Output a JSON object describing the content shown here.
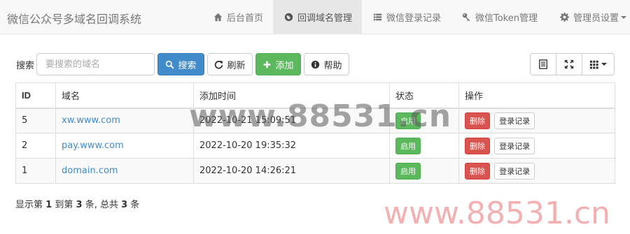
{
  "app": {
    "title": "微信公众号多域名回调系统"
  },
  "nav": {
    "home": {
      "label": "后台首页",
      "icon": "home-icon"
    },
    "domains": {
      "label": "回调域名管理",
      "icon": "globe-icon"
    },
    "login_logs": {
      "label": "微信登录记录",
      "icon": "list-icon"
    },
    "token": {
      "label": "微信Token管理",
      "icon": "key-icon"
    },
    "admin": {
      "label": "管理员设置",
      "icon": "gear-icon"
    }
  },
  "toolbar": {
    "search_label": "搜索",
    "search_placeholder": "要搜索的域名",
    "search_button": "搜索",
    "refresh_button": "刷新",
    "add_button": "添加",
    "help_button": "帮助"
  },
  "table": {
    "headers": {
      "id": "ID",
      "domain": "域名",
      "added_time": "添加时间",
      "status": "状态",
      "actions": "操作"
    },
    "rows": [
      {
        "id": "5",
        "domain": "xw.www.com",
        "added_time": "2022-10-21 15:09:51",
        "status": "启用",
        "delete": "删除",
        "login_log": "登录记录"
      },
      {
        "id": "2",
        "domain": "pay.www.com",
        "added_time": "2022-10-20 19:35:32",
        "status": "启用",
        "delete": "删除",
        "login_log": "登录记录"
      },
      {
        "id": "1",
        "domain": "domain.com",
        "added_time": "2022-10-20 14:26:21",
        "status": "启用",
        "delete": "删除",
        "login_log": "登录记录"
      }
    ]
  },
  "pagination": {
    "prefix": "显示第",
    "from": "1",
    "to_word": "到第",
    "to": "3",
    "mid": "条, 总共",
    "total": "3",
    "suffix": "条"
  },
  "watermarks": {
    "middle": "www.88531.cn",
    "corner": "www.88531.cn"
  },
  "colors": {
    "primary": "#428bca",
    "success": "#5cb85c",
    "danger": "#d9534f",
    "navbar_bg": "#f8f8f8"
  }
}
